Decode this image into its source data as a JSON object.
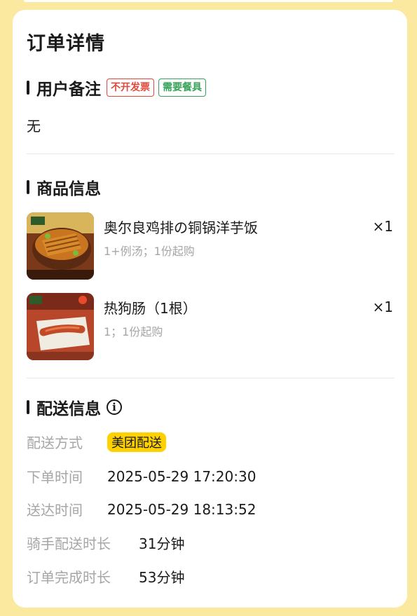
{
  "page": {
    "title": "订单详情"
  },
  "remark_section": {
    "title": "用户备注",
    "tags": [
      "不开发票",
      "需要餐具"
    ],
    "content": "无"
  },
  "products_section": {
    "title": "商品信息",
    "items": [
      {
        "name": "奥尔良鸡排の铜锅洋芋饭",
        "desc": "1+例汤；1份起购",
        "qty": "×1",
        "image": "chicken-rice-pot-photo"
      },
      {
        "name": "热狗肠（1根）",
        "desc": "1；1份起购",
        "qty": "×1",
        "image": "hot-dog-sausage-photo"
      }
    ]
  },
  "delivery_section": {
    "title": "配送信息",
    "info_icon": "info-icon",
    "rows": [
      {
        "label": "配送方式",
        "value": "美团配送"
      },
      {
        "label": "下单时间",
        "value": "2025-05-29 17:20:30"
      },
      {
        "label": "送达时间",
        "value": "2025-05-29 18:13:52"
      },
      {
        "label": "骑手配送时长",
        "value": "31分钟"
      },
      {
        "label": "订单完成时长",
        "value": "53分钟"
      }
    ]
  },
  "colors": {
    "background": "#fbe9a0",
    "accent_yellow": "#ffd100",
    "tag_red": "#e0483b",
    "tag_green": "#39a35a",
    "muted_text": "#a6a6a6"
  }
}
